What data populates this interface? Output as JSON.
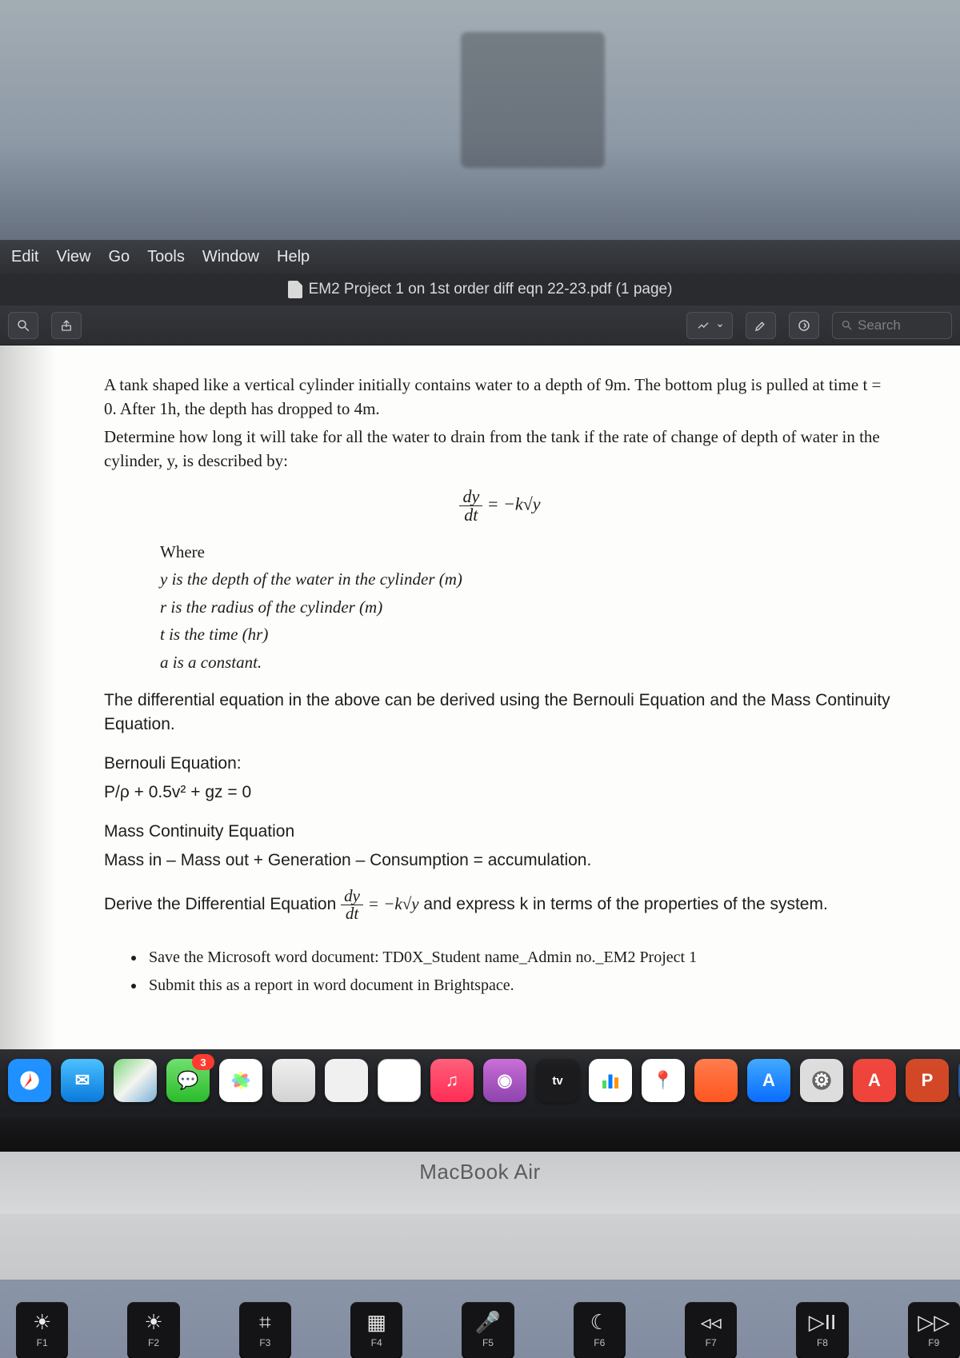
{
  "menubar": {
    "items": [
      "Edit",
      "View",
      "Go",
      "Tools",
      "Window",
      "Help"
    ]
  },
  "window": {
    "title": "EM2 Project 1 on 1st order diff eqn 22-23.pdf (1 page)"
  },
  "toolbar": {
    "search_placeholder": "Search"
  },
  "doc": {
    "p1": "A tank shaped like a vertical cylinder initially contains water to a depth of 9m. The bottom plug is pulled at time t = 0.  After 1h, the depth has dropped to 4m.",
    "p2": "Determine how long it will take for all the water to drain from the tank if the rate of change of depth of water in the cylinder, y, is described by:",
    "eq_lhs_top": "dy",
    "eq_lhs_bot": "dt",
    "eq_rhs": "= −k√y",
    "where": "Where",
    "w1": "y is the depth of the water in the cylinder (m)",
    "w2": "r is the radius of the cylinder (m)",
    "w3": "t is the time (hr)",
    "w4": "a is a constant.",
    "d1": "The differential equation in the above can be derived using the Bernouli Equation and the Mass Continuity Equation.",
    "d2": "Bernouli Equation:",
    "d3": "P/ρ + 0.5v² + gz = 0",
    "d4": "Mass Continuity Equation",
    "d5": "Mass in – Mass out + Generation – Consumption = accumulation.",
    "d6a": "Derive the Differential Equation ",
    "d6b": " and express k in terms of the properties of the system.",
    "b1": "Save the Microsoft word document: TD0X_Student name_Admin no._EM2 Project 1",
    "b2": "Submit this as a report in word document in Brightspace."
  },
  "dock": {
    "messages_badge": "3"
  },
  "brand": "MacBook Air",
  "keys": {
    "f1": {
      "g": "☀︎",
      "l": "F1"
    },
    "f2": {
      "g": "☀︎",
      "l": "F2"
    },
    "f3": {
      "g": "⌗",
      "l": "F3"
    },
    "f4": {
      "g": "▦",
      "l": "F4"
    },
    "f5": {
      "g": "🎤",
      "l": "F5"
    },
    "f6": {
      "g": "☾",
      "l": "F6"
    },
    "f7": {
      "g": "◃◃",
      "l": "F7"
    },
    "f8": {
      "g": "▷II",
      "l": "F8"
    },
    "f9": {
      "g": "▷▷",
      "l": "F9"
    }
  }
}
